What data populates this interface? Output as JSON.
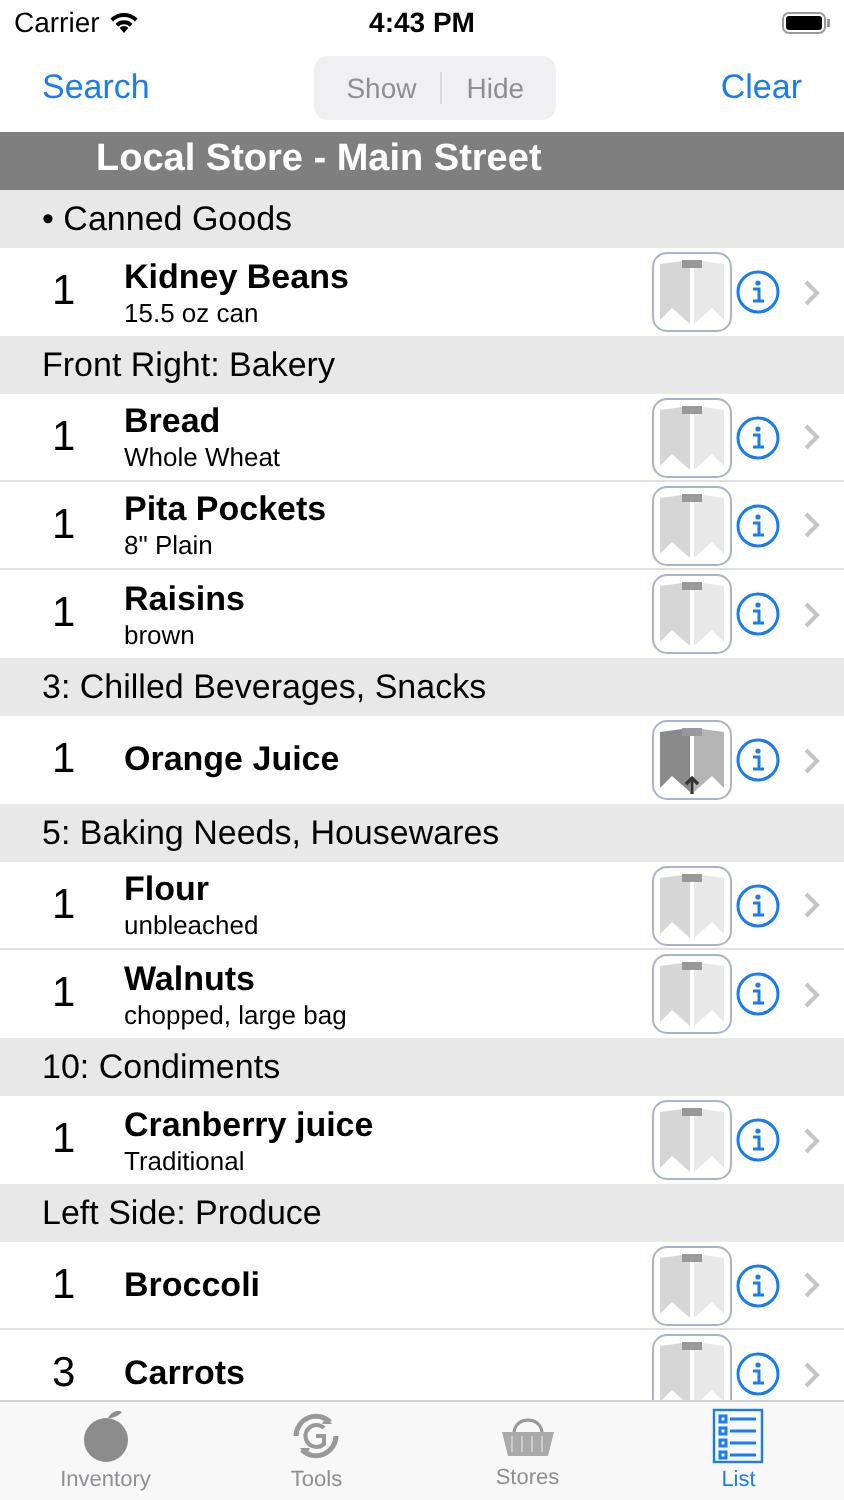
{
  "status_bar": {
    "carrier": "Carrier",
    "time": "4:43 PM"
  },
  "nav": {
    "left": "Search",
    "segments": [
      {
        "label": "Show",
        "disabled": true
      },
      {
        "label": "Hide",
        "disabled": true
      }
    ],
    "right": "Clear"
  },
  "store": "Local Store - Main Street",
  "sections": [
    {
      "title": "• Canned Goods",
      "items": [
        {
          "qty": "1",
          "name": "Kidney Beans",
          "note": "15.5 oz can",
          "active": false
        }
      ]
    },
    {
      "title": "Front Right: Bakery",
      "items": [
        {
          "qty": "1",
          "name": "Bread",
          "note": "Whole Wheat",
          "active": false
        },
        {
          "qty": "1",
          "name": "Pita Pockets",
          "note": "8\" Plain",
          "active": false
        },
        {
          "qty": "1",
          "name": "Raisins",
          "note": "brown",
          "active": false
        }
      ]
    },
    {
      "title": "3: Chilled Beverages, Snacks",
      "items": [
        {
          "qty": "1",
          "name": "Orange Juice",
          "active": true
        }
      ]
    },
    {
      "title": "5: Baking Needs, Housewares",
      "items": [
        {
          "qty": "1",
          "name": "Flour",
          "note": "unbleached",
          "active": false
        },
        {
          "qty": "1",
          "name": "Walnuts",
          "note": "chopped, large bag",
          "active": false
        }
      ]
    },
    {
      "title": "10: Condiments",
      "items": [
        {
          "qty": "1",
          "name": "Cranberry juice",
          "note": "Traditional",
          "active": false
        }
      ]
    },
    {
      "title": "Left Side: Produce",
      "items": [
        {
          "qty": "1",
          "name": "Broccoli",
          "active": false
        },
        {
          "qty": "3",
          "name": "Carrots",
          "active": false
        }
      ]
    }
  ],
  "tabs": [
    {
      "label": "Inventory",
      "selected": false
    },
    {
      "label": "Tools",
      "selected": false
    },
    {
      "label": "Stores",
      "selected": false
    },
    {
      "label": "List",
      "selected": true
    }
  ]
}
